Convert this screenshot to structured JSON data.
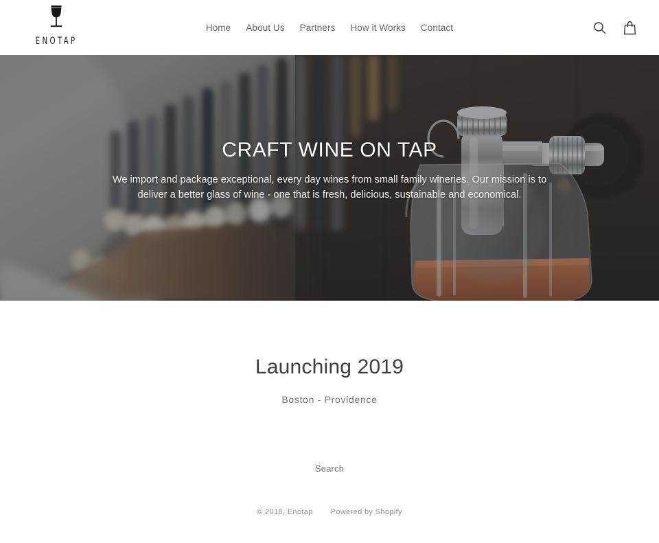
{
  "brand": {
    "name": "ENOTAP",
    "logo_icon": "wine-glass-icon"
  },
  "header": {
    "nav": [
      {
        "label": "Home"
      },
      {
        "label": "About Us"
      },
      {
        "label": "Partners"
      },
      {
        "label": "How it Works"
      },
      {
        "label": "Contact"
      }
    ],
    "icons": [
      {
        "name": "search-icon",
        "label": "Search"
      },
      {
        "name": "shopping-bag-icon",
        "label": "Cart"
      }
    ]
  },
  "hero": {
    "title": "CRAFT WINE ON TAP",
    "subtitle": "We import and package exceptional, every day wines from small family wineries. Our mission is to deliver a better glass of wine - one that is fresh, delicious, sustainable and economical.",
    "image_description": "Blurred row of wine bottles on left, chrome wine tap pouring into a glass growler of rosé on dark wood on right"
  },
  "main": {
    "title": "Launching 2019",
    "subtitle": "Boston - Providence"
  },
  "footer": {
    "search_label": "Search",
    "copyright": "© 2018, Enotap",
    "powered_by": "Powered by Shopify"
  },
  "colors": {
    "text_dark": "#3d4043",
    "text_muted": "#6f7477",
    "text_light": "#8b9093",
    "hero_text": "#ffffff",
    "background": "#ffffff"
  }
}
